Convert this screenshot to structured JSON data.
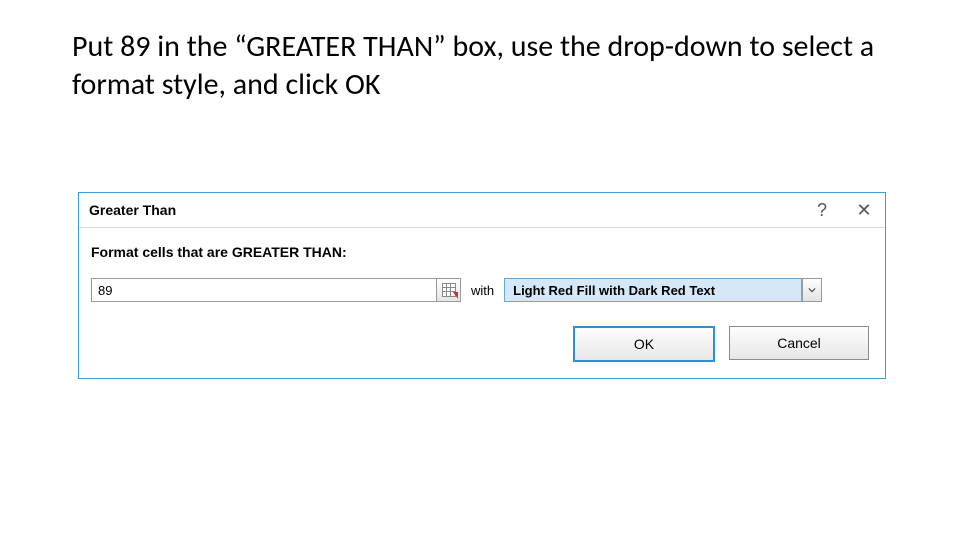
{
  "instruction": "Put 89 in the “GREATER THAN” box, use the drop-down to select a format style, and click OK",
  "dialog": {
    "title": "Greater Than",
    "help_glyph": "?",
    "close_glyph": "✕",
    "prompt": "Format cells that are GREATER THAN:",
    "value": "89",
    "with_label": "with",
    "format_selected": "Light Red Fill with Dark Red Text",
    "ok_label": "OK",
    "cancel_label": "Cancel"
  }
}
